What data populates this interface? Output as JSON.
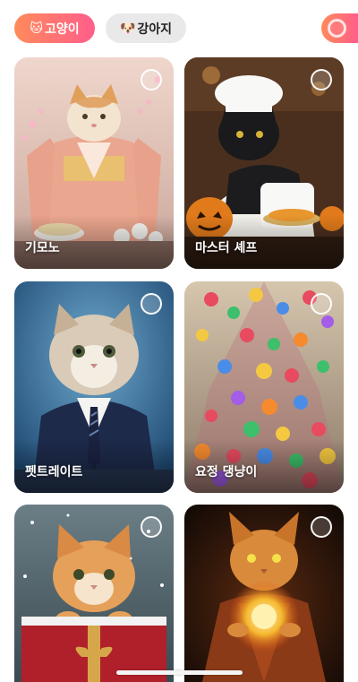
{
  "tabs": [
    {
      "icon": "cat-face-icon",
      "emoji": "🐱",
      "label": "고양이",
      "selected": true
    },
    {
      "icon": "dog-face-icon",
      "emoji": "🐶",
      "label": "강아지",
      "selected": false
    }
  ],
  "colors": {
    "accent_start": "#ff8a5b",
    "accent_end": "#ff5e8a",
    "chip_inactive": "#e9e9ea"
  },
  "styles": [
    {
      "label": "기모노",
      "theme": "kimono"
    },
    {
      "label": "마스터 셰프",
      "theme": "chef"
    },
    {
      "label": "펫트레이트",
      "theme": "portrait"
    },
    {
      "label": "요정 댕냥이",
      "theme": "candy-fairy"
    },
    {
      "label": "",
      "theme": "christmas-gift"
    },
    {
      "label": "",
      "theme": "fire-wizard"
    }
  ]
}
